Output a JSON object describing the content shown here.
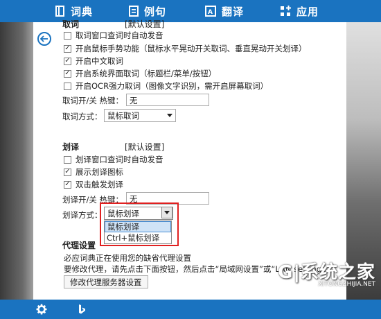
{
  "nav": {
    "items": [
      {
        "label": "词典",
        "icon": "book-icon"
      },
      {
        "label": "例句",
        "icon": "doc-icon"
      },
      {
        "label": "翻译",
        "icon": "translate-icon"
      },
      {
        "label": "应用",
        "icon": "apps-icon"
      }
    ]
  },
  "capture": {
    "heading": "取词",
    "default_link": "[默认设置]",
    "options": [
      {
        "label": "取词窗口查词时自动发音",
        "checked": false
      },
      {
        "label": "开启鼠标手势功能（鼠标水平晃动开关取词、垂直晃动开关划译）",
        "checked": true
      },
      {
        "label": "开启中文取词",
        "checked": true
      },
      {
        "label": "开启系统界面取词（标题栏/菜单/按钮）",
        "checked": true
      },
      {
        "label": "开启OCR强力取词（图像文字识别，需开启屏幕取词）",
        "checked": false
      }
    ],
    "hotkey_label": "取词开/关 热键：",
    "hotkey_value": "无",
    "mode_label": "取词方式：",
    "mode_value": "鼠标取词"
  },
  "select_translate": {
    "heading": "划译",
    "default_link": "[默认设置]",
    "options": [
      {
        "label": "划译窗口查词时自动发音",
        "checked": false
      },
      {
        "label": "展示划译图标",
        "checked": true
      },
      {
        "label": "双击触发划译",
        "checked": true
      }
    ],
    "hotkey_label": "划译开/关 热键：",
    "hotkey_value": "无",
    "mode_label": "划译方式：",
    "mode_value": "鼠标划译",
    "dropdown_options": [
      "鼠标划译",
      "Ctrl+鼠标划译"
    ],
    "dropdown_selected": "鼠标划译"
  },
  "proxy": {
    "heading": "代理设置",
    "line1": "必应词典正在使用您的缺省代理设置",
    "line2": "要修改代理，请先点击下面按钮，然后点击“局域网设置”或“LAN settings”",
    "button": "修改代理服务器设置"
  },
  "watermark": {
    "main": "G|系统之家",
    "sub": "XITONGZHIJIA.NET"
  },
  "colors": {
    "accent": "#1a73c0",
    "highlight_border": "#e02020"
  }
}
